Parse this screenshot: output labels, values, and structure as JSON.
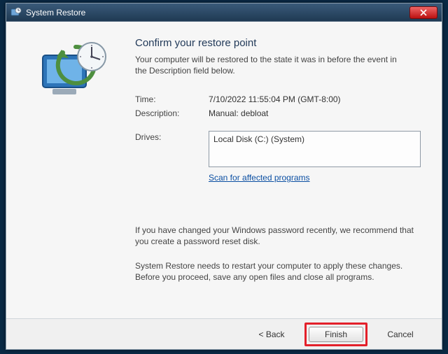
{
  "window": {
    "title": "System Restore"
  },
  "heading": "Confirm your restore point",
  "subtext": "Your computer will be restored to the state it was in before the event in the Description field below.",
  "fields": {
    "time_label": "Time:",
    "time_value": "7/10/2022 11:55:04 PM (GMT-8:00)",
    "description_label": "Description:",
    "description_value": "Manual: debloat",
    "drives_label": "Drives:",
    "drives_value": "Local Disk (C:) (System)"
  },
  "links": {
    "scan": "Scan for affected programs"
  },
  "notes": {
    "password": "If you have changed your Windows password recently, we recommend that you create a password reset disk.",
    "restart": "System Restore needs to restart your computer to apply these changes. Before you proceed, save any open files and close all programs."
  },
  "footer": {
    "back": "< Back",
    "finish": "Finish",
    "cancel": "Cancel"
  }
}
